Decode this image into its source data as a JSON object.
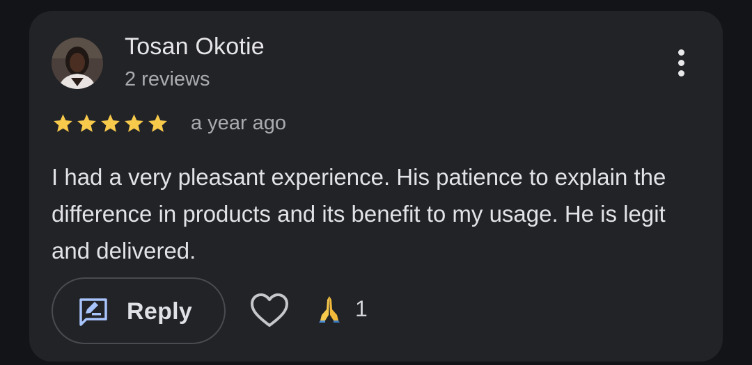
{
  "reviewer": {
    "name": "Tosan Okotie",
    "review_count": "2 reviews"
  },
  "review": {
    "rating": 5,
    "rating_max": 5,
    "time_ago": "a year ago",
    "text": "I had a very pleasant experience. His patience to explain the difference in products and its benefit to my usage. He is legit and delivered."
  },
  "actions": {
    "reply_label": "Reply",
    "reaction_count": "1"
  },
  "icons": {
    "avatar": "avatar",
    "more": "more-vert-icon",
    "star": "star-icon",
    "reply": "reply-icon",
    "like": "heart-icon",
    "reaction": "folded-hands-icon"
  },
  "colors": {
    "background": "#131417",
    "card": "#222327",
    "star": "#f8ca4c",
    "reply_icon": "#a8c4fb",
    "text_primary": "#e6e6e8",
    "text_secondary": "#a9abb0"
  }
}
